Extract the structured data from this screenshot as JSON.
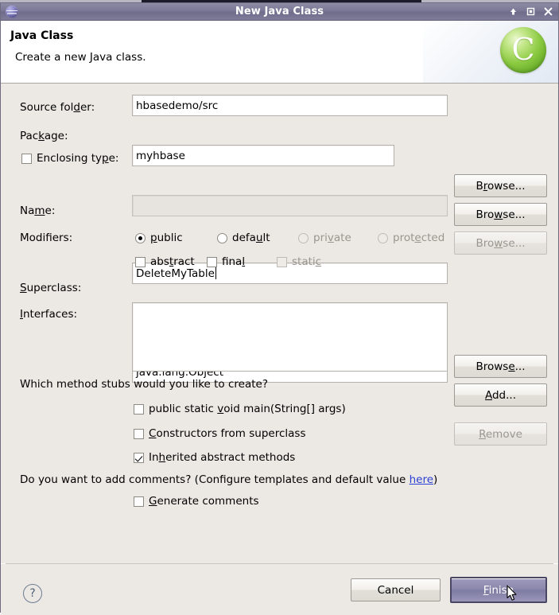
{
  "window": {
    "title": "New Java Class",
    "icon": "eclipse-sphere-icon",
    "controls": {
      "minimize": "minimize-icon",
      "maximize": "maximize-icon",
      "close": "close-icon"
    }
  },
  "banner": {
    "heading": "Java Class",
    "description": "Create a new Java class.",
    "logo_letter": "C"
  },
  "form": {
    "source_folder": {
      "label": "Source fol",
      "label_mnemonic": "d",
      "label_rest": "er:",
      "value": "hbasedemo/src",
      "browse": {
        "pre": "B",
        "mn": "r",
        "post": "owse..."
      }
    },
    "package": {
      "label": "Pac",
      "label_mnemonic": "k",
      "label_rest": "age:",
      "value": "myhbase",
      "browse": {
        "pre": "Bro",
        "mn": "w",
        "post": "se..."
      }
    },
    "enclosing_type": {
      "label": "Enclosing ty",
      "label_mnemonic": "p",
      "label_rest": "e:",
      "checked": false,
      "value": "",
      "disabled": true,
      "browse": {
        "pre": "Bro",
        "mn": "w",
        "post": "se..."
      }
    },
    "name": {
      "label": "Na",
      "label_mnemonic": "m",
      "label_rest": "e:",
      "value": "DeleteMyTable"
    },
    "modifiers": {
      "label": "Modifiers:",
      "access": [
        {
          "pre": "",
          "mn": "p",
          "post": "ublic",
          "selected": true,
          "disabled": false
        },
        {
          "pre": "defa",
          "mn": "u",
          "post": "lt",
          "selected": false,
          "disabled": false
        },
        {
          "pre": "pri",
          "mn": "v",
          "post": "ate",
          "selected": false,
          "disabled": true
        },
        {
          "pre": "prot",
          "mn": "e",
          "post": "cted",
          "selected": false,
          "disabled": true
        }
      ],
      "flags": [
        {
          "pre": "abs",
          "mn": "t",
          "post": "ract",
          "checked": false,
          "disabled": false
        },
        {
          "pre": "fina",
          "mn": "l",
          "post": "",
          "checked": false,
          "disabled": false
        },
        {
          "pre": "stati",
          "mn": "c",
          "post": "",
          "checked": false,
          "disabled": true
        }
      ]
    },
    "superclass": {
      "label_mnemonic": "S",
      "label_rest": "uperclass:",
      "value": "java.lang.Object",
      "browse": {
        "pre": "Brows",
        "mn": "e",
        "post": "..."
      }
    },
    "interfaces": {
      "label_mnemonic": "I",
      "label_rest": "nterfaces:",
      "items": [],
      "add": {
        "pre": "",
        "mn": "A",
        "post": "dd..."
      },
      "remove": {
        "pre": "",
        "mn": "R",
        "post": "emove",
        "disabled": true
      }
    },
    "stubs": {
      "question": "Which method stubs would you like to create?",
      "options": [
        {
          "pre": "public static ",
          "mn": "v",
          "post": "oid main(String[] args)",
          "checked": false
        },
        {
          "pre": "",
          "mn": "C",
          "post": "onstructors from superclass",
          "checked": false
        },
        {
          "pre": "In",
          "mn": "h",
          "post": "erited abstract methods",
          "checked": true
        }
      ]
    },
    "comments": {
      "question_pre": "Do you want to add comments? (Configure templates and default value ",
      "link": "here",
      "question_post": ")",
      "option": {
        "pre": "",
        "mn": "G",
        "post": "enerate comments",
        "checked": false
      }
    }
  },
  "footer": {
    "help": "?",
    "cancel": "Cancel",
    "finish": {
      "pre": "",
      "mn": "F",
      "post": "inish"
    }
  },
  "colors": {
    "dialog_bg": "#ece9e4",
    "titlebar": "#7b7896",
    "default_button": "#8b88ac",
    "link": "#2b3fd4",
    "logo_green": "#8dcb43"
  }
}
